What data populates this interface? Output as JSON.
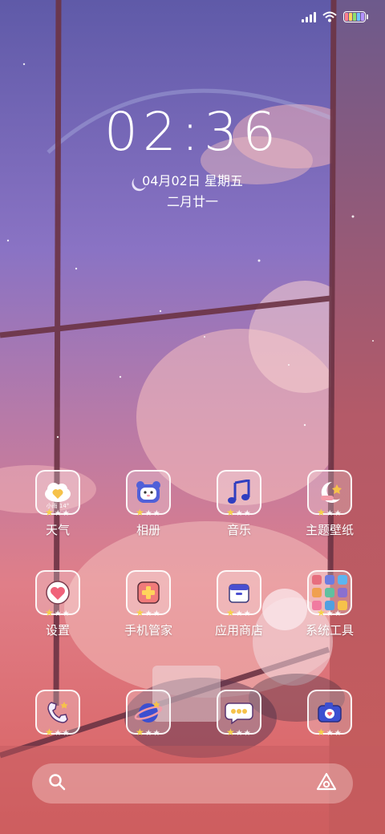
{
  "colors": {
    "sky_top": "#6a63b6",
    "sky_mid": "#8a73c4",
    "sky_low": "#d9808e",
    "sky_bottom": "#e76e67",
    "window_frame": "#7a3a4a",
    "wall": "#c05a59",
    "star_gold": "#f6d24a"
  },
  "status_bar": {
    "signal_icon": "signal-icon",
    "wifi_icon": "wifi-icon",
    "battery_icon": "battery-icon",
    "battery_colors": [
      "#ff7f8f",
      "#ffd35c",
      "#8ee06b",
      "#6cc6ff",
      "#b593ff"
    ]
  },
  "lockscreen": {
    "time": "02:36",
    "date": "04月02日 星期五",
    "lunar": "二月廿一"
  },
  "apps": [
    {
      "label": "天气",
      "icon": "weather-icon",
      "mini_text": "小雨 14°"
    },
    {
      "label": "相册",
      "icon": "gallery-icon"
    },
    {
      "label": "音乐",
      "icon": "music-icon"
    },
    {
      "label": "主题壁纸",
      "icon": "theme-icon"
    },
    {
      "label": "设置",
      "icon": "settings-icon"
    },
    {
      "label": "手机管家",
      "icon": "security-icon"
    },
    {
      "label": "应用商店",
      "icon": "app-store-icon"
    },
    {
      "label": "系统工具",
      "icon": "system-tools-folder-icon"
    }
  ],
  "dock": [
    {
      "icon": "phone-icon"
    },
    {
      "icon": "browser-icon"
    },
    {
      "icon": "messages-icon"
    },
    {
      "icon": "camera-icon"
    }
  ],
  "search": {
    "search_icon": "search-icon",
    "assistant_icon": "assistant-icon"
  }
}
